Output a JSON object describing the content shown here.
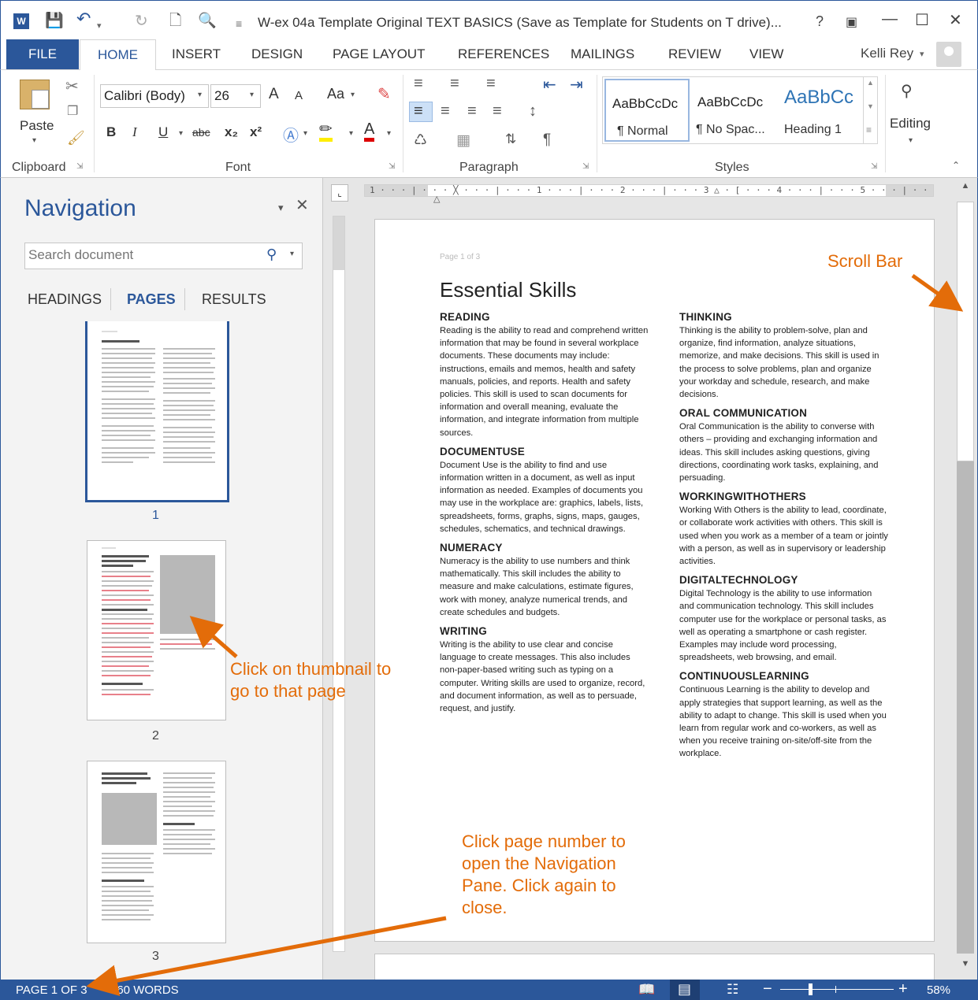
{
  "titlebar": {
    "title": "W-ex 04a Template Original TEXT BASICS (Save as Template for Students on T drive)...",
    "help": "?",
    "app_icon": "W"
  },
  "tabs": [
    "FILE",
    "HOME",
    "INSERT",
    "DESIGN",
    "PAGE LAYOUT",
    "REFERENCES",
    "MAILINGS",
    "REVIEW",
    "VIEW"
  ],
  "user": {
    "name": "Kelli Rey"
  },
  "ribbon": {
    "clipboard": {
      "paste": "Paste",
      "label": "Clipboard"
    },
    "font": {
      "name": "Calibri (Body)",
      "size": "26",
      "case_btn": "Aa",
      "bold": "B",
      "italic": "I",
      "underline": "U",
      "strike": "abc",
      "sub": "x₂",
      "sup": "x²",
      "grow": "A",
      "shrink": "A",
      "label": "Font"
    },
    "paragraph": {
      "label": "Paragraph"
    },
    "styles": {
      "items": [
        {
          "sample": "AaBbCcDc",
          "name": "¶ Normal"
        },
        {
          "sample": "AaBbCcDc",
          "name": "¶ No Spac..."
        },
        {
          "sample": "AaBbCc",
          "name": "Heading 1"
        }
      ],
      "label": "Styles"
    },
    "editing": {
      "label": "Editing"
    }
  },
  "navigation": {
    "title": "Navigation",
    "search_placeholder": "Search document",
    "tabs": [
      "HEADINGS",
      "PAGES",
      "RESULTS"
    ],
    "pages": [
      "1",
      "2",
      "3"
    ]
  },
  "document": {
    "page_header": "Page 1 of 3",
    "title": "Essential Skills",
    "left_col": [
      {
        "heading": "READING",
        "body": "Reading is the ability to read and comprehend written information that may be found in several workplace documents. These documents may include: instructions, emails and memos, health and safety manuals, policies, and reports. Health and safety policies. This skill is used to scan documents for information and overall meaning, evaluate the information, and integrate information from multiple sources."
      },
      {
        "heading": "DOCUMENTUSE",
        "body": "Document Use is the ability to find and use information written in a document, as well as input information as needed. Examples of documents you may use in the workplace are: graphics, labels,  lists, spreadsheets, forms, graphs, signs, maps, gauges, schedules, schematics, and technical drawings."
      },
      {
        "heading": "NUMERACY",
        "body": "Numeracy is the ability to use numbers and think mathematically. This skill includes the ability to measure and make calculations, estimate figures, work with money, analyze numerical trends, and create schedules and budgets."
      },
      {
        "heading": "WRITING",
        "body": "Writing is the ability to use clear and concise language to create messages. This also includes non-paper-based writing such as typing on a computer. Writing skills are used to organize, record, and document information, as well as to persuade, request, and justify."
      }
    ],
    "right_col": [
      {
        "heading": "THINKING",
        "body": "Thinking is the ability to problem-solve, plan and organize, find information, analyze situations, memorize, and make decisions. This skill is used in the process to solve problems, plan and organize your workday and schedule, research, and make decisions."
      },
      {
        "heading": "ORAL COMMUNICATION",
        "body": "Oral Communication is the ability to converse with others –  providing and exchanging information and ideas. This skill includes asking questions, giving directions, coordinating work tasks, explaining, and persuading."
      },
      {
        "heading": "WORKINGWITHOTHERS",
        "body": "Working With Others is the ability to lead, coordinate, or collaborate work activities with others. This skill is used when you work as a member of a team or jointly with a person, as well as in supervisory or leadership activities."
      },
      {
        "heading": "DIGITALTECHNOLOGY",
        "body": "Digital Technology is the ability to use information and communication technology. This skill includes computer use for the workplace or personal tasks, as well as operating a smartphone or cash register. Examples may include word processing, spreadsheets, web browsing, and email."
      },
      {
        "heading": "CONTINUOUSLEARNING",
        "body": "Continuous Learning is the ability to develop and apply strategies that support learning, as well as the ability to adapt to change. This skill is used when you learn from regular work and co-workers, as well as when you receive training on-site/off-site from the workplace."
      }
    ]
  },
  "statusbar": {
    "page": "PAGE 1 OF 3",
    "words": "960 WORDS",
    "zoom": "58%",
    "zoom_level_percent": 58
  },
  "annotations": {
    "scroll_bar": "Scroll Bar",
    "thumbnail_line1": "Click on thumbnail to",
    "thumbnail_line2": "go to that page",
    "pagenum_line1": "Click page number to",
    "pagenum_line2": "open the Navigation",
    "pagenum_line3": "Pane. Click again to",
    "pagenum_line4": "close."
  },
  "colors": {
    "accent": "#2b579a",
    "annotation": "#e36c09"
  }
}
